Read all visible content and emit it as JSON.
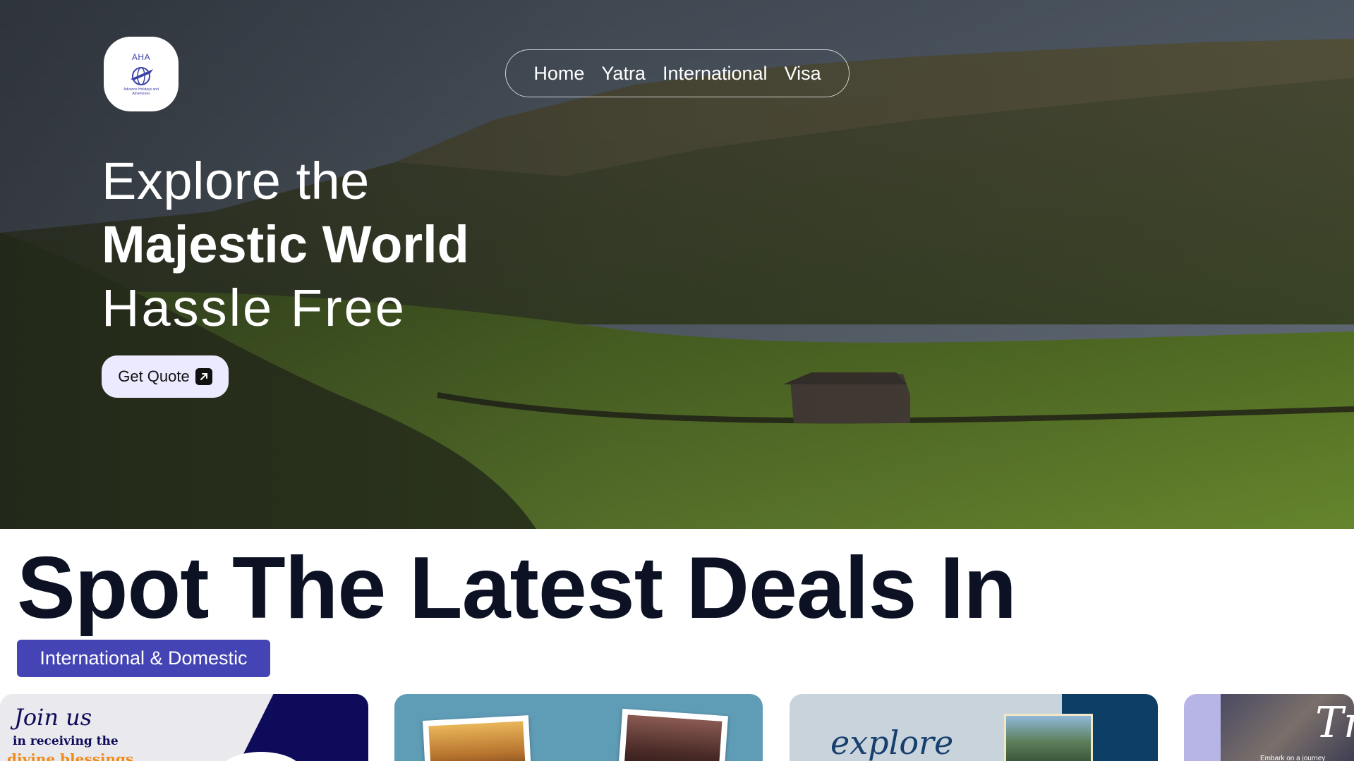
{
  "logo": {
    "text": "AHA",
    "tagline": "Advance Holidays and Adventures"
  },
  "nav": {
    "items": [
      "Home",
      "Yatra",
      "International",
      "Visa"
    ]
  },
  "hero": {
    "line1": "Explore the",
    "line2": "Majestic World",
    "line3": "Hassle Free",
    "cta_label": "Get Quote",
    "cta_icon": "arrow-up-right-icon"
  },
  "deals": {
    "title": "Spot The Latest Deals In",
    "badge": "International & Domestic"
  },
  "cards": [
    {
      "script": "Join us",
      "text": "in receiving the",
      "highlight": "divine blessings"
    },
    {},
    {
      "script": "explore"
    },
    {
      "script": "Tr",
      "small": "Embark on a journey"
    }
  ],
  "colors": {
    "accent": "#4444b5",
    "title": "#0c1224",
    "button_bg": "#eceaff"
  }
}
